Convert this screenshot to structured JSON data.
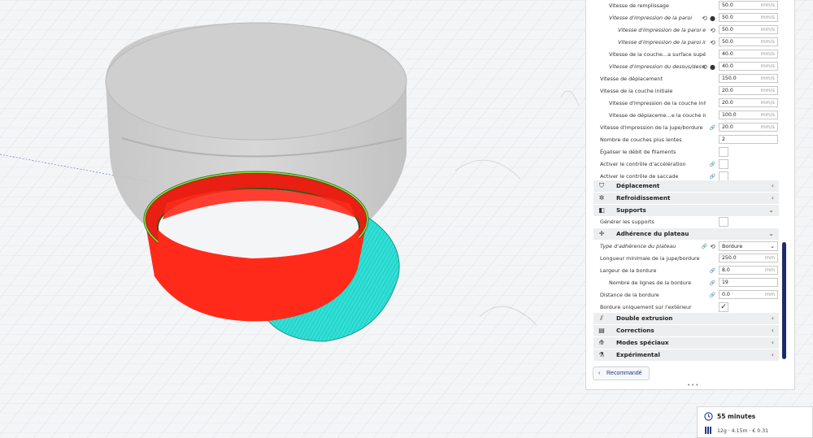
{
  "colors": {
    "accent": "#1d2a6b",
    "model_red": "#ff2a1a",
    "skirt_cyan": "#2fe0d6",
    "ghost_gray": "#c9c9c9",
    "panel_bg": "#ffffff",
    "category_bg": "#eceef0"
  },
  "settings": {
    "speed_rows": [
      {
        "label": "Vitesse de remplissage",
        "value": "50.0",
        "unit": "mm/s",
        "italic": false,
        "indent": 1,
        "icons": []
      },
      {
        "label": "Vitesse d'impression de la paroi",
        "value": "50.0",
        "unit": "mm/s",
        "italic": true,
        "indent": 1,
        "icons": [
          "reset-icon",
          "info-icon"
        ]
      },
      {
        "label": "Vitesse d'impression de la paroi externe",
        "value": "50.0",
        "unit": "mm/s",
        "italic": true,
        "indent": 2,
        "icons": [
          "reset-icon"
        ]
      },
      {
        "label": "Vitesse d'impression de la paroi interne",
        "value": "50.0",
        "unit": "mm/s",
        "italic": true,
        "indent": 2,
        "icons": [
          "reset-icon"
        ]
      },
      {
        "label": "Vitesse de la couche…a surface supérieure",
        "value": "40.0",
        "unit": "mm/s",
        "italic": false,
        "indent": 1,
        "icons": []
      },
      {
        "label": "Vitesse d'impression du dessus/dessous",
        "value": "40.0",
        "unit": "mm/s",
        "italic": true,
        "indent": 1,
        "icons": [
          "reset-icon",
          "info-icon"
        ]
      },
      {
        "label": "Vitesse de déplacement",
        "value": "150.0",
        "unit": "mm/s",
        "italic": false,
        "indent": 0,
        "icons": []
      },
      {
        "label": "Vitesse de la couche initiale",
        "value": "20.0",
        "unit": "mm/s",
        "italic": false,
        "indent": 0,
        "icons": []
      },
      {
        "label": "Vitesse d'impression de la couche initiale",
        "value": "20.0",
        "unit": "mm/s",
        "italic": false,
        "indent": 1,
        "icons": []
      },
      {
        "label": "Vitesse de déplaceme…e la couche initiale",
        "value": "100.0",
        "unit": "mm/s",
        "italic": false,
        "indent": 1,
        "icons": []
      },
      {
        "label": "Vitesse d'impression de la jupe/bordure",
        "value": "20.0",
        "unit": "mm/s",
        "italic": false,
        "indent": 0,
        "icons": [
          "link-icon"
        ]
      },
      {
        "label": "Nombre de couches plus lentes",
        "value": "2",
        "unit": "",
        "italic": false,
        "indent": 0,
        "icons": []
      }
    ],
    "speed_checks": [
      {
        "label": "Égaliser le débit de filaments",
        "checked": false,
        "icons": []
      },
      {
        "label": "Activer le contrôle d'accélération",
        "checked": false,
        "icons": [
          "link-icon"
        ]
      },
      {
        "label": "Activer le contrôle de saccade",
        "checked": false,
        "icons": [
          "link-icon"
        ]
      }
    ],
    "categories_top": [
      {
        "label": "Déplacement",
        "icon": "travel-icon",
        "chevron": "‹"
      },
      {
        "label": "Refroidissement",
        "icon": "cooling-fan-icon",
        "chevron": "‹"
      },
      {
        "label": "Supports",
        "icon": "support-icon",
        "chevron": "⌄"
      }
    ],
    "supports_row": {
      "label": "Générer les supports",
      "checked": false
    },
    "adhesion_category": {
      "label": "Adhérence du plateau",
      "icon": "adhesion-icon",
      "chevron": "⌄"
    },
    "adhesion_type": {
      "label": "Type d'adhérence du plateau",
      "value": "Bordure"
    },
    "adhesion_rows": [
      {
        "label": "Longueur minimale de la jupe/bordure",
        "value": "250.0",
        "unit": "mm",
        "indent": 0,
        "icons": []
      },
      {
        "label": "Largeur de la bordure",
        "value": "8.0",
        "unit": "mm",
        "indent": 0,
        "icons": [
          "link-icon"
        ]
      },
      {
        "label": "Nombre de lignes de la bordure",
        "value": "19",
        "unit": "",
        "indent": 1,
        "icons": [
          "link-icon"
        ]
      },
      {
        "label": "Distance de la bordure",
        "value": "0.0",
        "unit": "mm",
        "indent": 0,
        "icons": [
          "link-icon"
        ]
      }
    ],
    "brim_outside_row": {
      "label": "Bordure uniquement sur l'extérieur",
      "checked": true
    },
    "categories_bottom": [
      {
        "label": "Double extrusion",
        "icon": "dual-extrusion-icon",
        "chevron": "‹"
      },
      {
        "label": "Corrections",
        "icon": "mesh-fix-icon",
        "chevron": "‹"
      },
      {
        "label": "Modes spéciaux",
        "icon": "special-modes-icon",
        "chevron": "‹"
      },
      {
        "label": "Expérimental",
        "icon": "experimental-icon",
        "chevron": "‹"
      }
    ]
  },
  "footer": {
    "recommended_label": "Recommandé",
    "grip": "•••"
  },
  "estimate": {
    "time": "55 minutes",
    "details": "12g · 4.15m · € 0.31"
  }
}
